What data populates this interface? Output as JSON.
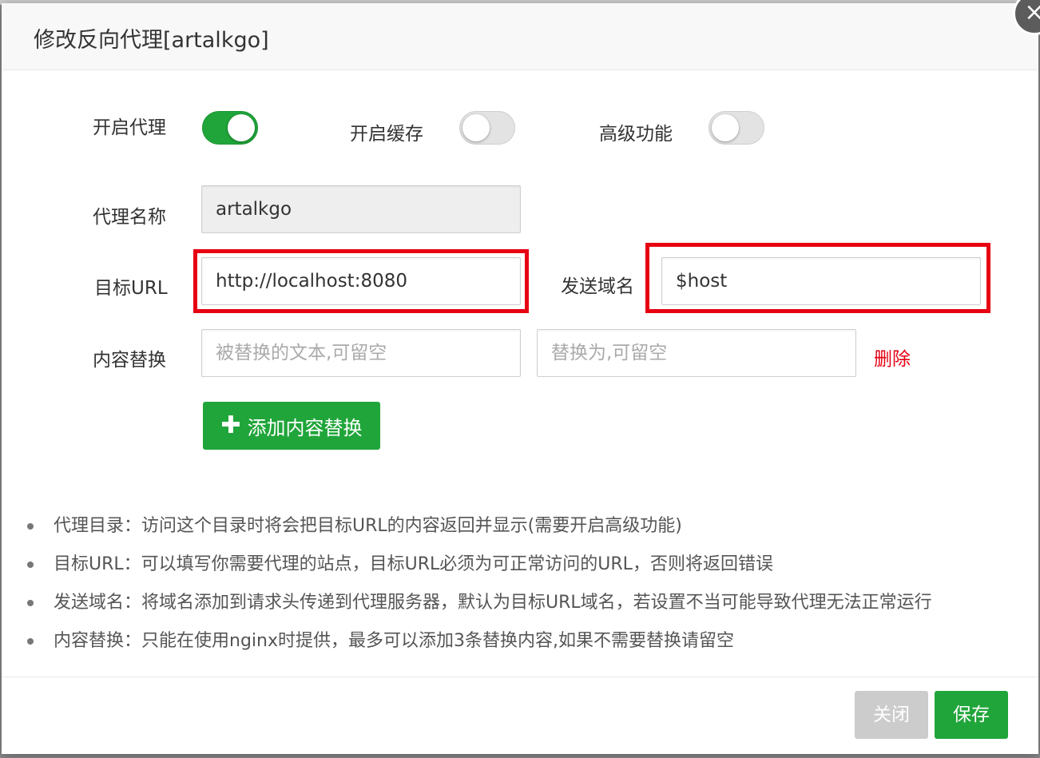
{
  "dialog": {
    "title": "修改反向代理[artalkgo]",
    "close_icon": "×"
  },
  "form": {
    "enable_proxy": {
      "label": "开启代理",
      "on": true
    },
    "enable_cache": {
      "label": "开启缓存",
      "on": false
    },
    "advanced": {
      "label": "高级功能",
      "on": false
    },
    "proxy_name": {
      "label": "代理名称",
      "value": "artalkgo"
    },
    "target_url": {
      "label": "目标URL",
      "value": "http://localhost:8080"
    },
    "send_domain": {
      "label": "发送域名",
      "value": "$host"
    },
    "content_replace": {
      "label": "内容替换",
      "from_placeholder": "被替换的文本,可留空",
      "to_placeholder": "替换为,可留空",
      "delete_label": "删除"
    },
    "add_replace_button": {
      "icon": "plus-icon",
      "label": "添加内容替换"
    }
  },
  "notes": [
    "代理目录：访问这个目录时将会把目标URL的内容返回并显示(需要开启高级功能)",
    "目标URL：可以填写你需要代理的站点，目标URL必须为可正常访问的URL，否则将返回错误",
    "发送域名：将域名添加到请求头传递到代理服务器，默认为目标URL域名，若设置不当可能导致代理无法正常运行",
    "内容替换：只能在使用nginx时提供，最多可以添加3条替换内容,如果不需要替换请留空"
  ],
  "footer": {
    "close_label": "关闭",
    "save_label": "保存"
  },
  "colors": {
    "accent_green": "#20a53a",
    "danger_red": "#e60012",
    "highlight_red": "#e60012"
  }
}
